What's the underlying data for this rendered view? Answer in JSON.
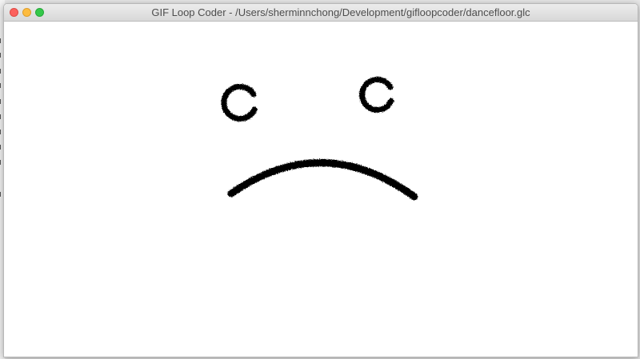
{
  "window": {
    "title": "GIF Loop Coder - /Users/sherminnchong/Development/gifloopcoder/dancefloor.glc"
  },
  "controls": {
    "close": "close-button",
    "minimize": "minimize-button",
    "maximize": "zoom-button"
  },
  "canvas": {
    "background": "#ffffff",
    "stroke_color": "#000000",
    "drawing": "frowning face"
  }
}
